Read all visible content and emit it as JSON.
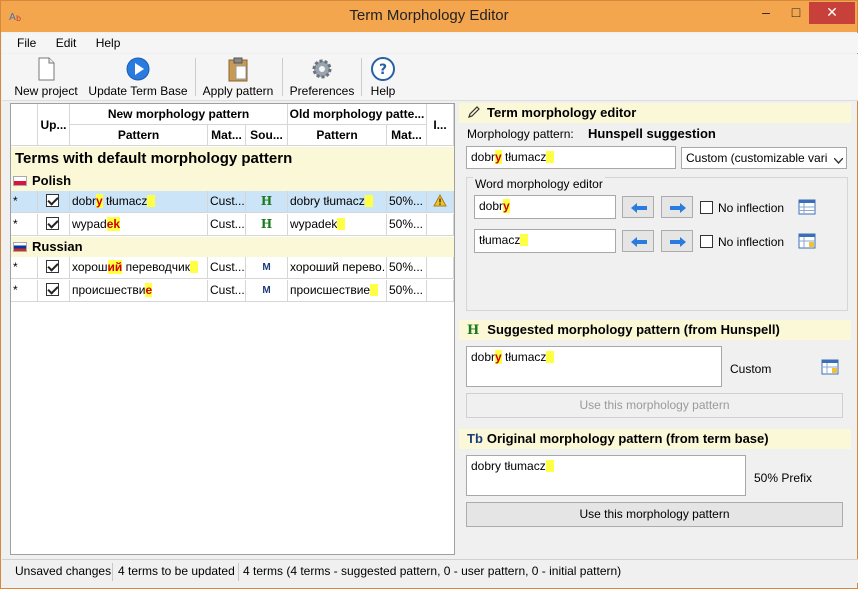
{
  "window": {
    "title": "Term Morphology Editor",
    "minimize": "–",
    "maximize": "□",
    "close": "✕"
  },
  "menu": [
    "File",
    "Edit",
    "Help"
  ],
  "toolbar": {
    "new_project": "New project",
    "update_term_base": "Update Term Base",
    "apply_pattern": "Apply pattern",
    "preferences": "Preferences",
    "help": "Help"
  },
  "grid": {
    "header_update": "Up...",
    "header_new_group": "New morphology pattern",
    "header_old_group": "Old morphology patte...",
    "header_pattern": "Pattern",
    "header_match": "Mat...",
    "header_source": "Sou...",
    "header_old_pattern": "Pattern",
    "header_old_match": "Mat...",
    "header_info": "I...",
    "section_title": "Terms with default morphology pattern",
    "groups": [
      {
        "language": "Polish",
        "rows": [
          {
            "marker": "*",
            "pattern_pre": "dobr",
            "pattern_end": "y",
            "pattern_mid": " tłumacz",
            "pattern_tail_blank": true,
            "type": "Cust...",
            "source_icon": "H",
            "old_pattern": "dobry tłumacz",
            "old_match": "50%...",
            "warning": true
          },
          {
            "marker": "*",
            "pattern_pre": "wypad",
            "pattern_end": "ek",
            "pattern_mid": "",
            "pattern_tail_blank": false,
            "type": "Cust...",
            "source_icon": "H",
            "old_pattern": "wypadek",
            "old_match": "50%...",
            "warning": false
          }
        ]
      },
      {
        "language": "Russian",
        "rows": [
          {
            "marker": "*",
            "pattern_pre": "хорош",
            "pattern_end": "ий",
            "pattern_mid": " переводчик",
            "pattern_tail_blank": true,
            "type": "Cust...",
            "source_icon": "M",
            "old_pattern": "хороший перево...",
            "old_match": "50%...",
            "warning": false
          },
          {
            "marker": "*",
            "pattern_pre": "происшестви",
            "pattern_end": "е",
            "pattern_mid": "",
            "pattern_tail_blank": false,
            "type": "Cust...",
            "source_icon": "M",
            "old_pattern": "происшествие",
            "old_match": "50%...",
            "warning": false
          }
        ]
      }
    ]
  },
  "editor": {
    "title": "Term morphology editor",
    "pattern_label": "Morphology pattern:",
    "pattern_suggestion": "Hunspell suggestion",
    "pattern_value_pre": "dobr",
    "pattern_value_end": "y",
    "pattern_value_mid": " tłumacz",
    "type_select": "Custom (customizable vari",
    "word_editor_label": "Word morphology editor",
    "words": [
      {
        "pre": "dobr",
        "end": "y",
        "no_inflection": "No inflection"
      },
      {
        "pre": "tłumacz",
        "end": "",
        "no_inflection": "No inflection"
      }
    ]
  },
  "suggested": {
    "icon": "H",
    "title": "Suggested morphology pattern (from Hunspell)",
    "value_pre": "dobr",
    "value_end": "y",
    "value_mid": " tłumacz",
    "type": "Custom",
    "button": "Use this morphology pattern"
  },
  "original": {
    "icon": "Tb",
    "title": "Original morphology pattern (from term base)",
    "value": "dobry tłumacz",
    "type": "50% Prefix",
    "button": "Use this morphology pattern"
  },
  "status": {
    "unsaved": "Unsaved changes",
    "to_update": "4 terms to be updated",
    "summary": "4 terms (4 terms - suggested pattern, 0 - user pattern, 0 - initial pattern)"
  }
}
